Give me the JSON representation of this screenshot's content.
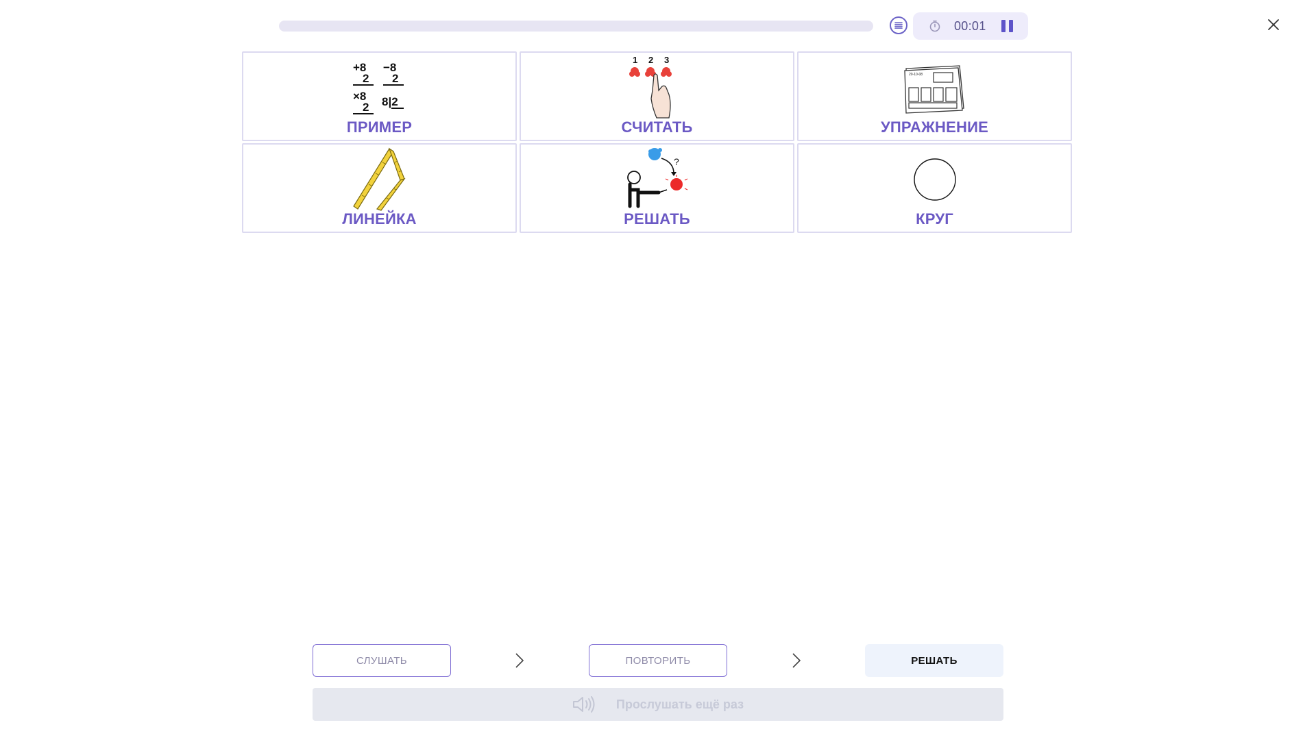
{
  "header": {
    "progress_percent": 0,
    "timer": "00:01"
  },
  "cards": [
    {
      "label": "ПРИМЕР",
      "pic_text": [
        "+8",
        "2",
        "−8",
        "2",
        "×8",
        "2",
        "8|2"
      ]
    },
    {
      "label": "СЧИТАТЬ",
      "pic_text": [
        "1",
        "2",
        "3"
      ]
    },
    {
      "label": "УПРАЖНЕНИЕ",
      "pic_text": [
        "20-10-08"
      ]
    },
    {
      "label": "ЛИНЕЙКА"
    },
    {
      "label": "РЕШАТЬ",
      "pic_text": [
        "?"
      ]
    },
    {
      "label": "КРУГ"
    }
  ],
  "steps": {
    "listen": "СЛУШАТЬ",
    "repeat": "ПОВТОРИТЬ",
    "solve": "РЕШАТЬ",
    "active": "solve"
  },
  "listen_again": "Прослушать ещё раз",
  "colors": {
    "accent": "#6b59c4",
    "card_border": "#dcdaf0",
    "timer_bg": "#eeecfb",
    "active_step_bg": "#eef3fc",
    "disabled_bar": "#e6e8ef"
  },
  "icons": [
    "list-icon",
    "stopwatch-icon",
    "pause-icon",
    "close-icon",
    "chevron-right-icon",
    "speaker-icon"
  ]
}
